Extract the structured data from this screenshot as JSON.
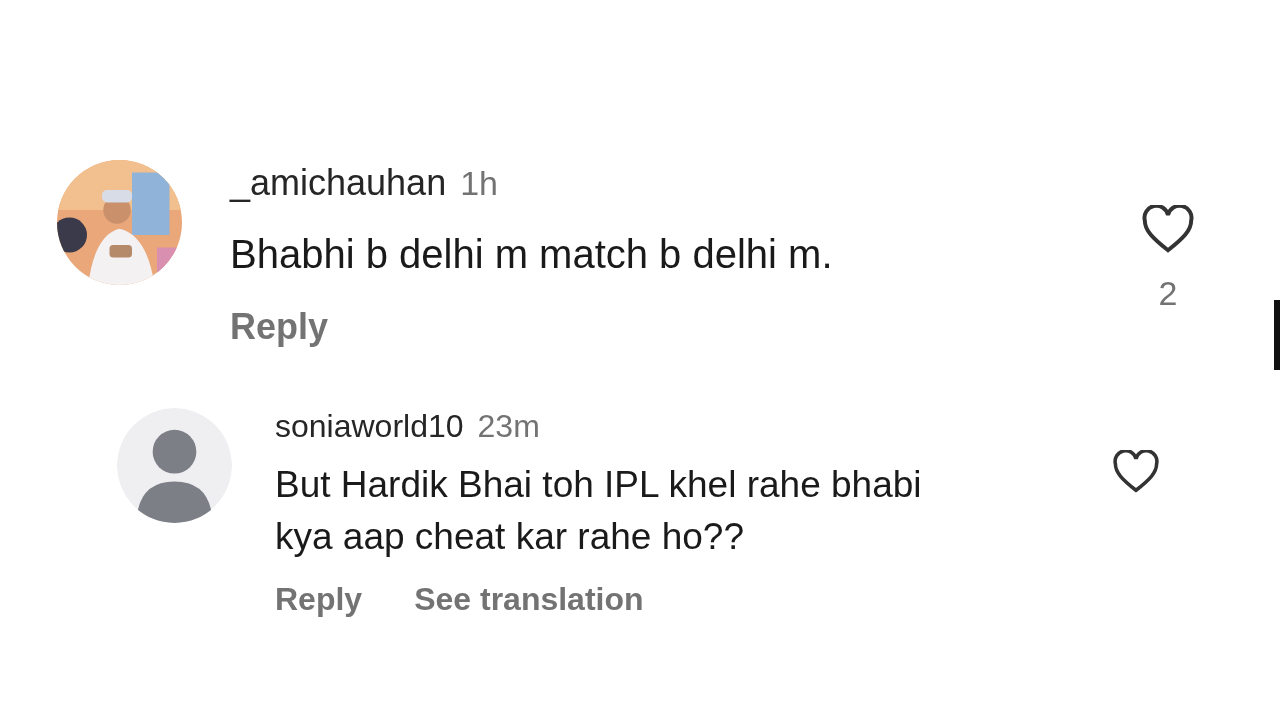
{
  "comments": [
    {
      "avatar": {
        "kind": "picture"
      },
      "username": "_amichauhan",
      "time": "1h",
      "text": "Bhabhi b delhi m match b delhi m.",
      "actions": [
        "Reply"
      ],
      "liked": false,
      "like_count": "2",
      "reply": false
    },
    {
      "avatar": {
        "kind": "placeholder"
      },
      "username": "soniaworld10",
      "time": "23m",
      "text": "But Hardik Bhai toh IPL khel rahe bhabi kya aap cheat kar rahe ho??",
      "actions": [
        "Reply",
        "See translation"
      ],
      "liked": false,
      "reply": true
    }
  ]
}
